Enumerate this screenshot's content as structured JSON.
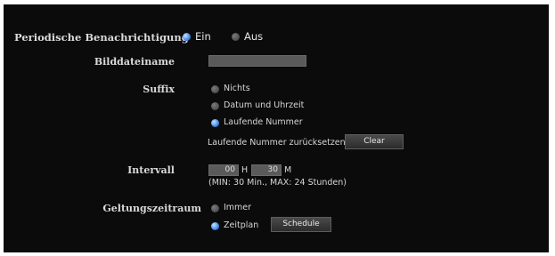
{
  "notification": {
    "label": "Periodische Benachrichtigung",
    "on_label": "Ein",
    "off_label": "Aus",
    "selected": "Ein"
  },
  "image_filename": {
    "label": "Bilddateiname",
    "value": ""
  },
  "suffix": {
    "label": "Suffix",
    "options": [
      "Nichts",
      "Datum und Uhrzeit",
      "Laufende Nummer"
    ],
    "selected": "Laufende Nummer",
    "reset_label": "Laufende Nummer zurücksetzen",
    "clear_button": "Clear"
  },
  "interval": {
    "label": "Intervall",
    "hours": "00",
    "hours_unit": "H",
    "minutes": "30",
    "minutes_unit": "M",
    "hint": "(MIN: 30 Min., MAX: 24 Stunden)"
  },
  "validity": {
    "label": "Geltungszeitraum",
    "options": [
      "Immer",
      "Zeitplan"
    ],
    "selected": "Zeitplan",
    "schedule_button": "Schedule"
  }
}
